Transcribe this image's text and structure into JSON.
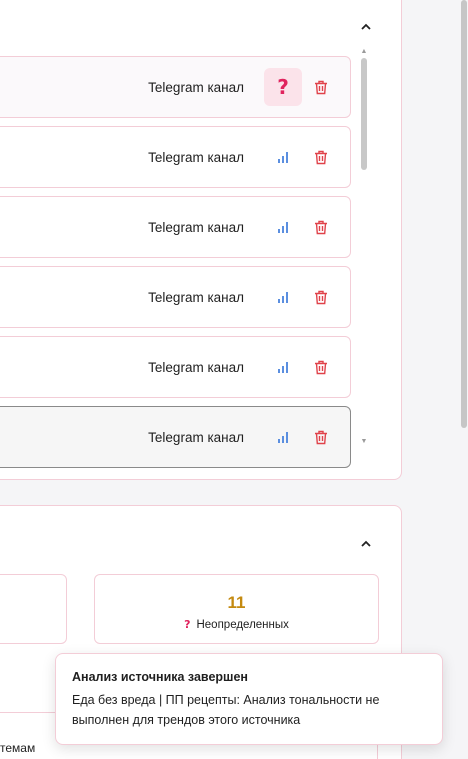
{
  "sources_panel": {
    "rows": [
      {
        "label": "Telegram канал",
        "status": "question"
      },
      {
        "label": "Telegram канал",
        "status": "chart"
      },
      {
        "label": "Telegram канал",
        "status": "chart"
      },
      {
        "label": "Telegram канал",
        "status": "chart"
      },
      {
        "label": "Telegram канал",
        "status": "chart"
      },
      {
        "label": "Telegram канал",
        "status": "chart"
      }
    ]
  },
  "stats_panel": {
    "undetermined": {
      "value": "11",
      "label": "Неопределенных"
    }
  },
  "bottom_partial_text": "темам",
  "toast": {
    "title": "Анализ источника завершен",
    "message": "Еда без вреда | ПП рецепты: Анализ тональности не выполнен для трендов этого источника"
  },
  "colors": {
    "accent_pink": "#e0245e",
    "delete_red": "#e0424a",
    "chart_blue": "#5b8fe0",
    "stat_gold": "#c48a10",
    "border_pink": "#f3cdd7"
  },
  "icons": {
    "collapse": "chevron-up-icon",
    "question": "question-mark-icon",
    "chart": "signal-bars-icon",
    "delete": "trash-icon"
  }
}
